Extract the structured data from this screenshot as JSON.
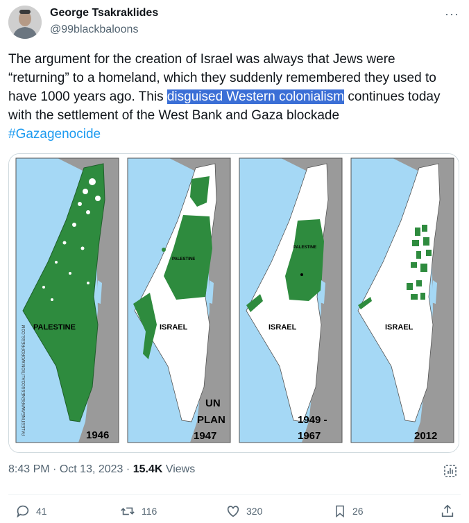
{
  "author": {
    "name": "George Tsakraklides",
    "handle": "@99blackbaloons"
  },
  "menu_icon": "more-dots-icon",
  "tweet": {
    "text_before": "The argument for the creation of Israel was always that Jews were “returning” to a homeland, which they suddenly remembered they used to have 1000 years ago. This ",
    "highlight": "disguised Western colonialism",
    "text_after": " continues today with the settlement of the West Bank and Gaza blockade",
    "hashtag": "#Gazagenocide"
  },
  "media": {
    "panels": [
      {
        "year": "1946",
        "label": "PALESTINE"
      },
      {
        "year_line1": "UN",
        "year_line2": "PLAN",
        "year_line3": "1947",
        "small_label": "PALESTINE",
        "label": "ISRAEL"
      },
      {
        "year_line1": "1949 -",
        "year_line2": "1967",
        "small_label": "PALESTINE",
        "label": "ISRAEL"
      },
      {
        "year": "2012",
        "label": "ISRAEL"
      }
    ],
    "side_credit": "PALESTINEAWARENESSCOALITION.WORDPRESS.COM"
  },
  "meta": {
    "time": "8:43 PM",
    "dot": "·",
    "date": "Oct 13, 2023",
    "views_count": "15.4K",
    "views_label": "Views"
  },
  "actions": {
    "replies": "41",
    "reposts": "116",
    "likes": "320",
    "bookmarks": "26"
  },
  "colors": {
    "text": "#0f1419",
    "muted": "#536471",
    "link": "#1d9bf0",
    "highlight": "#3b6fd6",
    "sea": "#a5d8f5",
    "land_green": "#2e8b3e",
    "land_gray": "#9a9a9a"
  }
}
